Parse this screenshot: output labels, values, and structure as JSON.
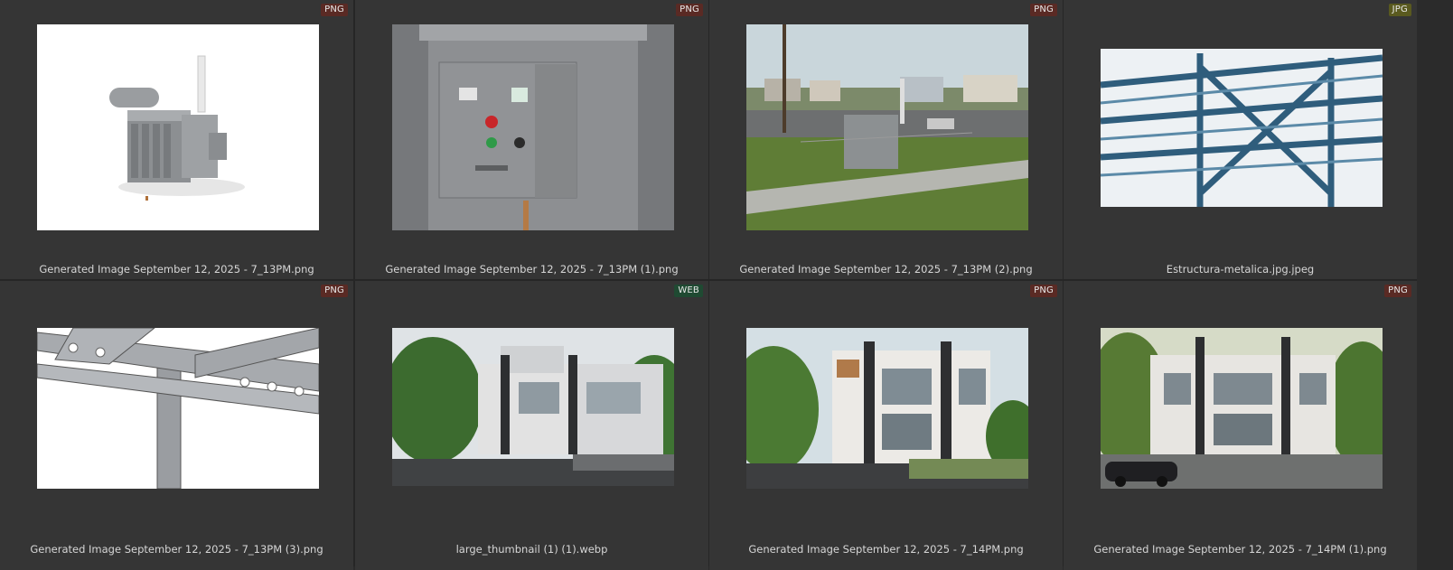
{
  "colors": {
    "png_badge": "#5a2a24",
    "jpg_badge": "#5a5a1f",
    "web_badge": "#1f4a32",
    "background": "#262626",
    "cell": "#353535"
  },
  "items": [
    {
      "name": "Generated Image September 12, 2025 - 7_13PM.png",
      "badge": "PNG"
    },
    {
      "name": "Generated Image September 12, 2025 - 7_13PM (1).png",
      "badge": "PNG"
    },
    {
      "name": "Generated Image September 12, 2025 - 7_13PM (2).png",
      "badge": "PNG"
    },
    {
      "name": "Estructura-metalica.jpg.jpeg",
      "badge": "JPG"
    },
    {
      "name": "Generated Image September 12, 2025 - 7_13PM (3).png",
      "badge": "PNG"
    },
    {
      "name": "large_thumbnail (1) (1).webp",
      "badge": "WEB"
    },
    {
      "name": "Generated Image September 12, 2025 - 7_14PM.png",
      "badge": "PNG"
    },
    {
      "name": "Generated Image September 12, 2025 - 7_14PM (1).png",
      "badge": "PNG"
    }
  ]
}
